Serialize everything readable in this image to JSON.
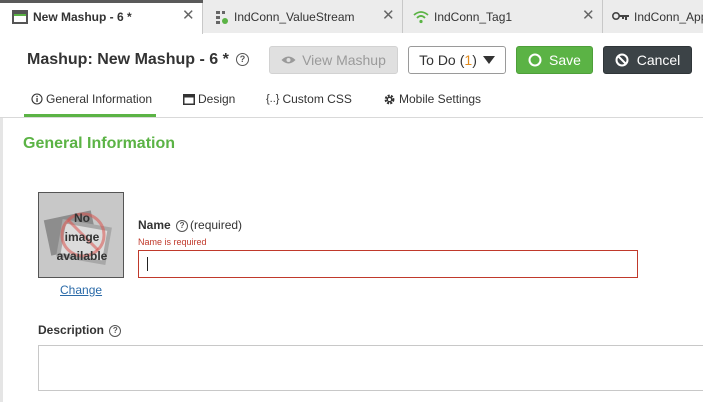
{
  "tabs": [
    {
      "label": "New Mashup - 6 *",
      "icon": "mashup-icon",
      "active": true
    },
    {
      "label": "IndConn_ValueStream",
      "icon": "value-stream-icon",
      "active": false
    },
    {
      "label": "IndConn_Tag1",
      "icon": "wifi-icon",
      "active": false
    },
    {
      "label": "IndConn_App",
      "icon": "key-icon",
      "active": false
    }
  ],
  "tab_close_symbol": "✕",
  "header": {
    "title": "Mashup: New Mashup - 6 *",
    "help_symbol": "?",
    "view_mashup_label": "View Mashup",
    "todo_label": "To Do",
    "todo_count_open": "(",
    "todo_count": "1",
    "todo_count_close": ")",
    "save_label": "Save",
    "cancel_label": "Cancel"
  },
  "nav": {
    "general": "General Information",
    "design": "Design",
    "custom_css": "Custom CSS",
    "mobile": "Mobile Settings"
  },
  "section": {
    "title": "General Information"
  },
  "image": {
    "line1": "No",
    "line2": "image",
    "line3": "available",
    "change_link": "Change"
  },
  "name_field": {
    "label": "Name",
    "required_text": "(required)",
    "error": "Name is required",
    "value": ""
  },
  "description_field": {
    "label": "Description",
    "value": ""
  },
  "colors": {
    "accent": "#5bb345",
    "error": "#c0392b",
    "todo_count": "#e08a1e"
  }
}
